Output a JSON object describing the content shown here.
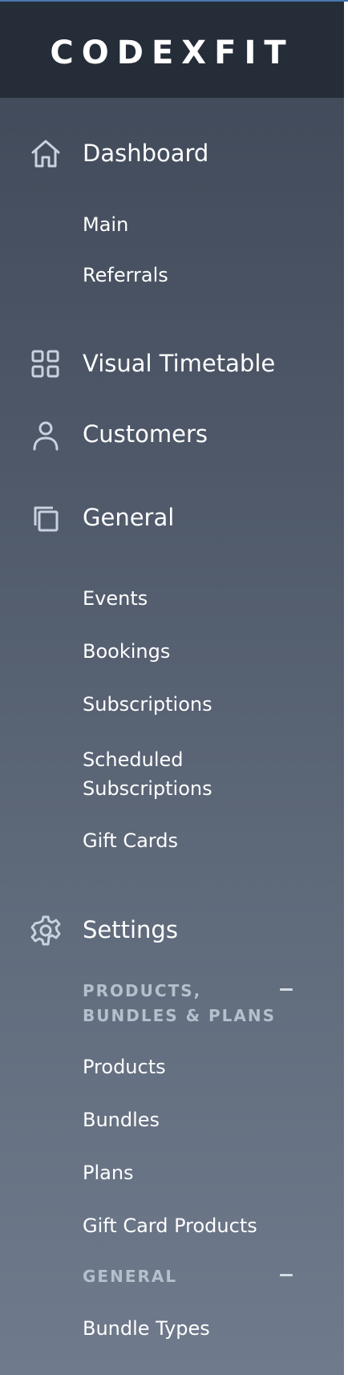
{
  "brand": {
    "logo_text": "CODEXFIT"
  },
  "nav": {
    "dashboard": {
      "label": "Dashboard",
      "icon": "home-icon",
      "children": [
        "Main",
        "Referrals"
      ]
    },
    "visual_timetable": {
      "label": "Visual Timetable",
      "icon": "grid-icon"
    },
    "customers": {
      "label": "Customers",
      "icon": "user-icon"
    },
    "general": {
      "label": "General",
      "icon": "copy-icon",
      "children": [
        "Events",
        "Bookings",
        "Subscriptions",
        "Scheduled",
        "Subscriptions",
        "Gift Cards"
      ]
    },
    "settings": {
      "label": "Settings",
      "icon": "gear-icon",
      "groups": [
        {
          "heading_line1": "PRODUCTS,",
          "heading_line2": "BUNDLES & PLANS",
          "toggle": "−",
          "items": [
            "Products",
            "Bundles",
            "Plans",
            "Gift Card Products"
          ]
        },
        {
          "heading_line1": "GENERAL",
          "toggle": "−",
          "items": [
            "Bundle Types"
          ]
        }
      ]
    }
  },
  "colors": {
    "brand_bar": "#252d38",
    "sidebar_top": "#3f4857",
    "sidebar_bottom": "#6f7a8c",
    "group_heading": "#b6bfcc",
    "top_accent": "#4a78b0"
  }
}
